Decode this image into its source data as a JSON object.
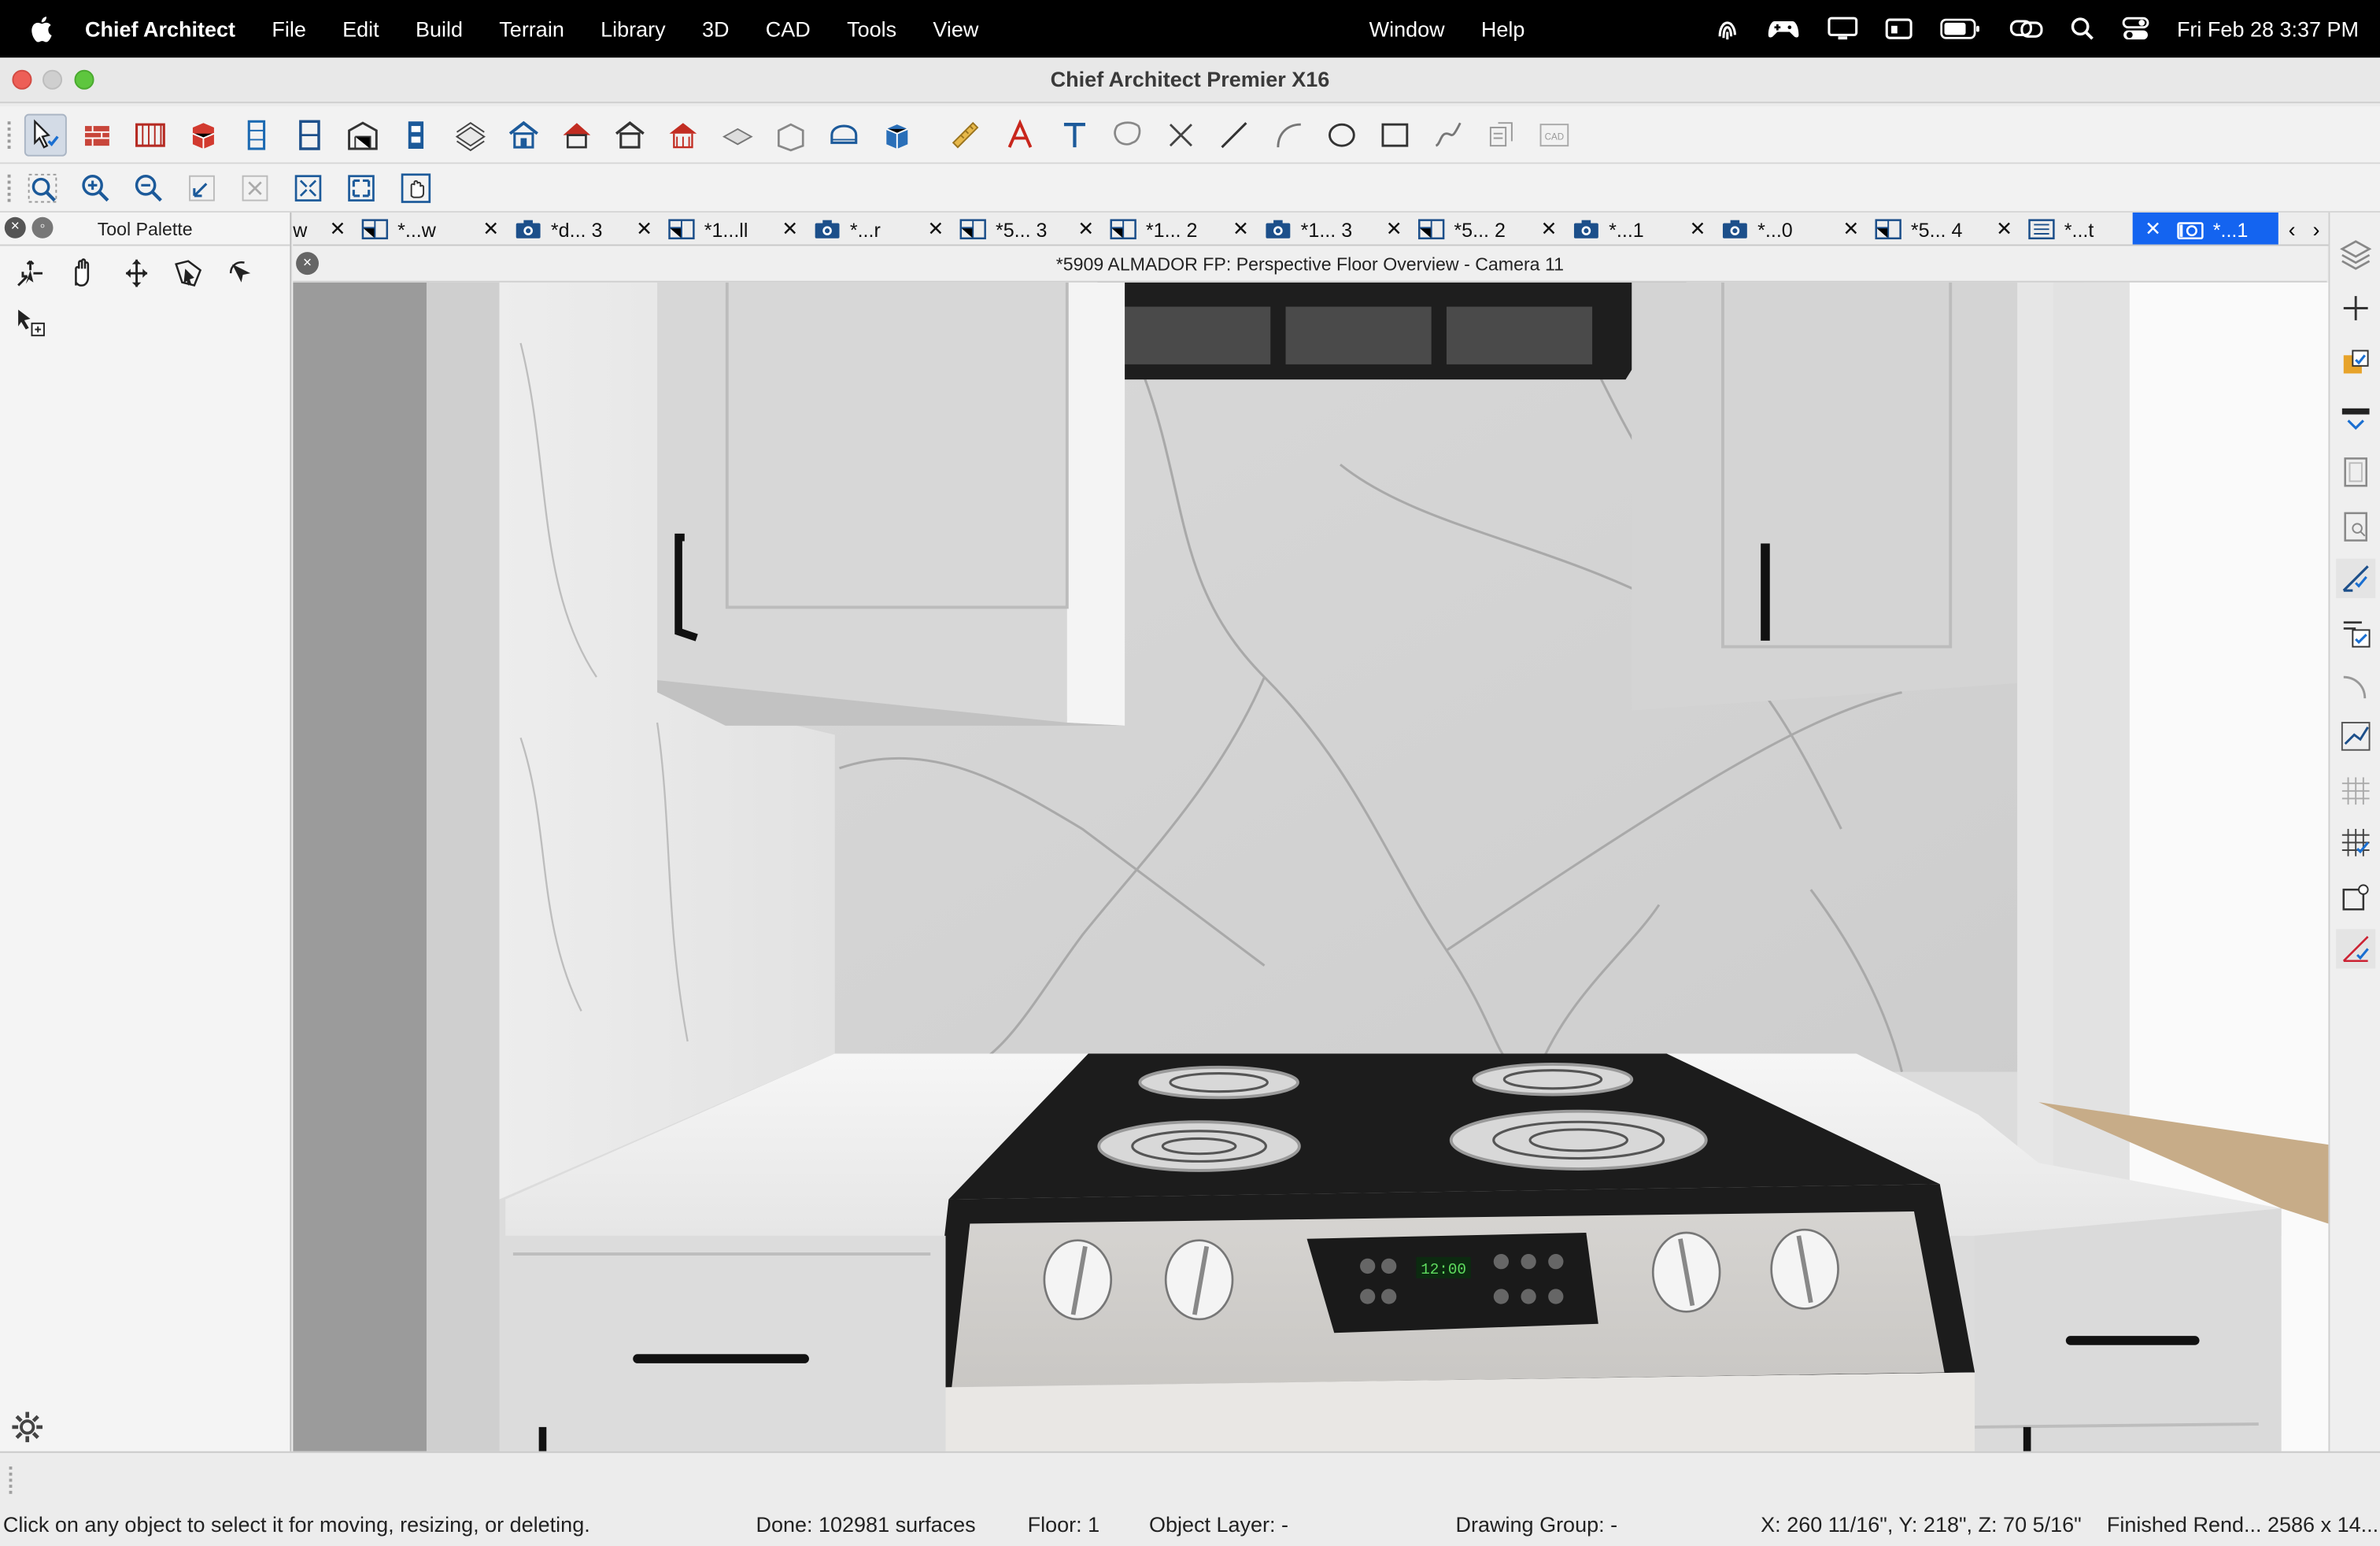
{
  "menubar": {
    "app_name": "Chief Architect",
    "items": [
      "File",
      "Edit",
      "Build",
      "Terrain",
      "Library",
      "3D",
      "CAD",
      "Tools",
      "View"
    ],
    "right_items": [
      "Window",
      "Help"
    ],
    "clock": "Fri Feb 28  3:37 PM"
  },
  "window": {
    "title": "Chief Architect Premier X16"
  },
  "palette": {
    "title": "Tool Palette"
  },
  "tabs": [
    {
      "label": "w",
      "active": false
    },
    {
      "label": "*...w",
      "active": false
    },
    {
      "label": "*d... 3",
      "active": false
    },
    {
      "label": "*1...ll",
      "active": false
    },
    {
      "label": "*...r",
      "active": false
    },
    {
      "label": "*5... 3",
      "active": false
    },
    {
      "label": "*1... 2",
      "active": false
    },
    {
      "label": "*1... 3",
      "active": false
    },
    {
      "label": "*5... 2",
      "active": false
    },
    {
      "label": "*...1",
      "active": false
    },
    {
      "label": "*...0",
      "active": false
    },
    {
      "label": "*5... 4",
      "active": false
    },
    {
      "label": "*...t",
      "active": false
    },
    {
      "label": "*...1",
      "active": true
    }
  ],
  "view": {
    "title": "*5909 ALMADOR FP: Perspective Floor Overview - Camera 11",
    "oven_clock": "12:00"
  },
  "status": {
    "hint": "Click on any object to select it for moving, resizing, or deleting.",
    "done": "Done:  102981 surfaces",
    "floor": "Floor: 1",
    "layer": "Object Layer: -",
    "group": "Drawing Group: -",
    "coords": "X: 260 11/16\", Y: 218\", Z: 70 5/16\"",
    "render": "Finished Rend...  2586 x 14..."
  },
  "colors": {
    "accent": "#1464f0",
    "cabinet": "#dadada",
    "cooktop": "#1c1c1c",
    "oven_body": "#d4d2cf"
  }
}
